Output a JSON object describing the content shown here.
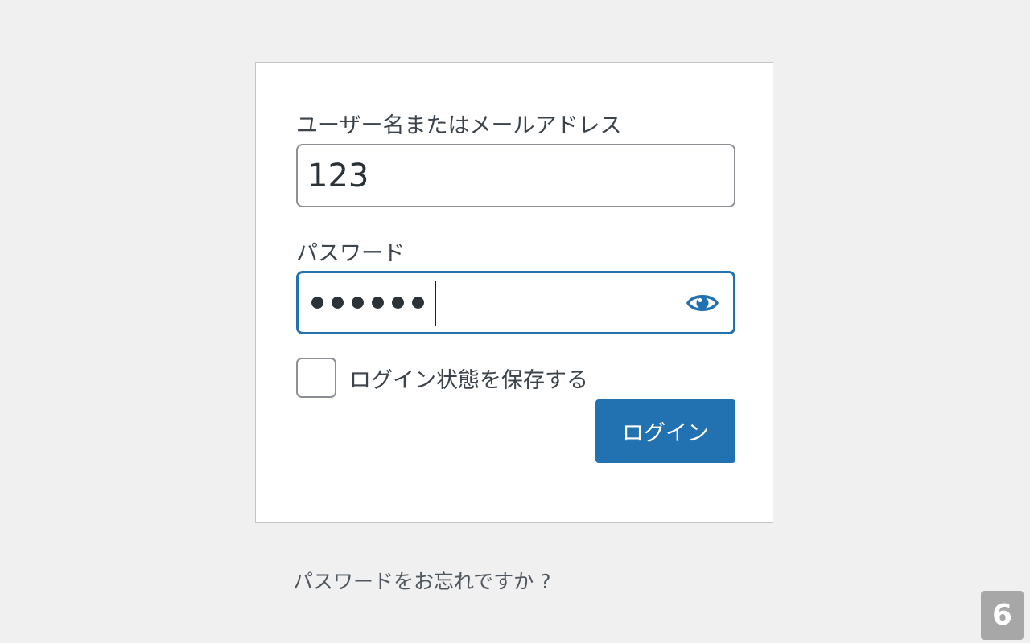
{
  "form": {
    "username_label": "ユーザー名またはメールアドレス",
    "username_value": "123",
    "password_label": "パスワード",
    "password_masked_length": 6,
    "show_password_icon": "eye-icon",
    "remember_label": "ログイン状態を保存する",
    "remember_checked": false,
    "submit_label": "ログイン"
  },
  "links": {
    "lost_password": "パスワードをお忘れですか ?"
  },
  "badge": {
    "value": "6"
  },
  "colors": {
    "background": "#f0f0f1",
    "accent": "#2271b1",
    "text": "#3c434a"
  }
}
